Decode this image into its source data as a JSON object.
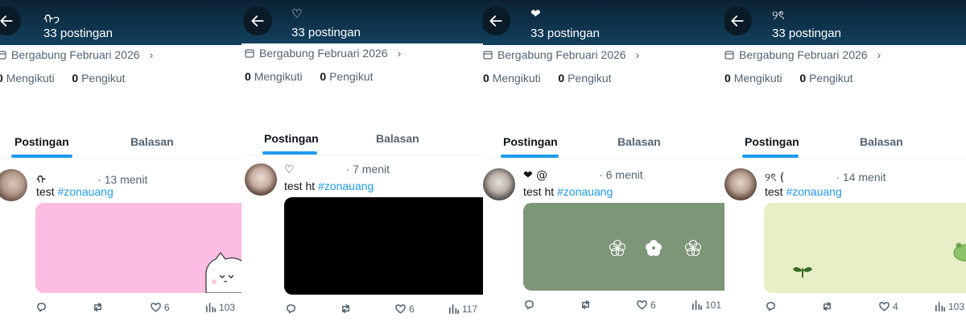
{
  "panels": [
    {
      "header": {
        "name": "ᡣ𐭩",
        "posts_count": "33 postingan"
      },
      "joined": "Bergabung Februari 2026",
      "following_count": "0",
      "following_label": "Mengikuti",
      "followers_count": "0",
      "followers_label": "Pengikut",
      "tabs": {
        "active": "Postingan",
        "inactive": "Balasan"
      },
      "post": {
        "name": "ᡣ",
        "time": "· 13 menit",
        "text": "test ",
        "hashtag": "#zonauang",
        "media_color": "#fbbde2",
        "likes": "6",
        "views": "103"
      }
    },
    {
      "header": {
        "name": "♡",
        "posts_count": "33 postingan"
      },
      "joined": "Bergabung Februari 2026",
      "following_count": "0",
      "following_label": "Mengikuti",
      "followers_count": "0",
      "followers_label": "Pengikut",
      "tabs": {
        "active": "Postingan",
        "inactive": "Balasan"
      },
      "post": {
        "name": "♡",
        "time": "· 7 menit",
        "text": "test ht ",
        "hashtag": "#zonauang",
        "media_color": "#000000",
        "likes": "6",
        "views": "117"
      }
    },
    {
      "header": {
        "name": "❤",
        "posts_count": "33 postingan"
      },
      "joined": "Bergabung Februari 2026",
      "following_count": "0",
      "following_label": "Mengikuti",
      "followers_count": "0",
      "followers_label": "Pengikut",
      "tabs": {
        "active": "Postingan",
        "inactive": "Balasan"
      },
      "post": {
        "name": "❤ @",
        "time": "· 6 menit",
        "text": "test ht ",
        "hashtag": "#zonauang",
        "media_color": "#7d9678",
        "likes": "6",
        "views": "101"
      }
    },
    {
      "header": {
        "name": "୨ৎ",
        "posts_count": "33 postingan"
      },
      "joined": "Bergabung Februari 2026",
      "following_count": "0",
      "following_label": "Mengikuti",
      "followers_count": "0",
      "followers_label": "Pengikut",
      "tabs": {
        "active": "Postingan",
        "inactive": "Balasan"
      },
      "post": {
        "name": "୨ৎ (",
        "time": "· 14 menit",
        "text": "test ",
        "hashtag": "#zonauang",
        "media_color": "#e6efc5",
        "likes": "4",
        "views": "103"
      }
    }
  ],
  "colors": {
    "accent": "#1d9bf0",
    "header_bg": "#12405e",
    "muted_text": "#536471"
  },
  "icons": [
    "back-arrow-icon",
    "calendar-icon",
    "chevron-right-icon",
    "reply-icon",
    "repost-icon",
    "like-icon",
    "views-icon"
  ]
}
